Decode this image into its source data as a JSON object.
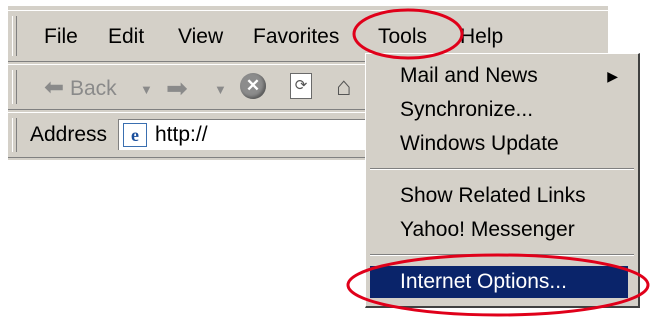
{
  "menubar": {
    "file": "File",
    "edit": "Edit",
    "view": "View",
    "favorites": "Favorites",
    "tools": "Tools",
    "help": "Help"
  },
  "toolbar": {
    "back_label": "Back",
    "stop_glyph": "✕"
  },
  "address": {
    "label": "Address",
    "value": "http://"
  },
  "tools_menu": {
    "items": [
      {
        "label": "Mail and News",
        "has_submenu": true
      },
      {
        "label": "Synchronize..."
      },
      {
        "label": "Windows Update"
      },
      {
        "label": "Show Related Links"
      },
      {
        "label": "Yahoo! Messenger"
      },
      {
        "label": "Internet Options..."
      }
    ],
    "selected": "Internet Options..."
  },
  "colors": {
    "window": "#d4d0c8",
    "selection": "#0a246a",
    "annotation": "#e0001a"
  }
}
